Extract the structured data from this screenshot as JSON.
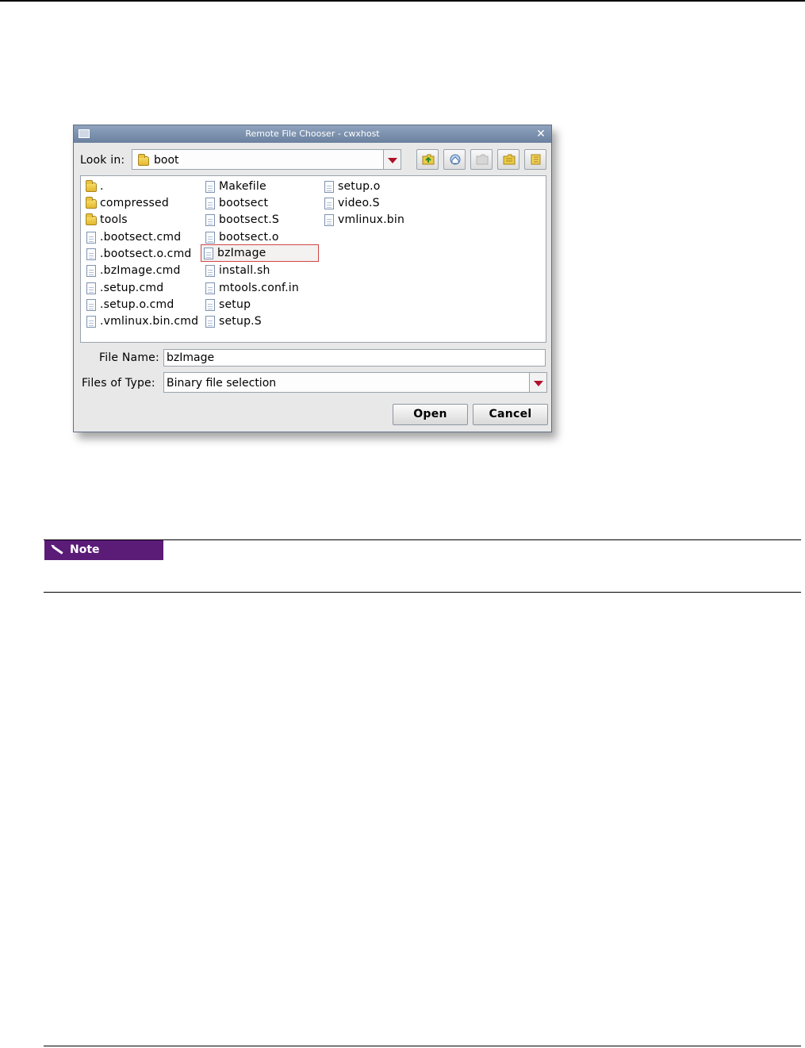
{
  "dialog": {
    "title": "Remote File Chooser - cwxhost",
    "close_glyph": "✕",
    "look_in_label": "Look in:",
    "look_in_value": "boot",
    "toolbar_icons": [
      "up-folder-icon",
      "home-icon",
      "new-folder-icon",
      "list-view-icon",
      "details-view-icon"
    ],
    "files": {
      "col1": [
        {
          "name": ".",
          "type": "folder"
        },
        {
          "name": "compressed",
          "type": "folder"
        },
        {
          "name": "tools",
          "type": "folder"
        },
        {
          "name": ".bootsect.cmd",
          "type": "file"
        },
        {
          "name": ".bootsect.o.cmd",
          "type": "file"
        },
        {
          "name": ".bzImage.cmd",
          "type": "file"
        },
        {
          "name": ".setup.cmd",
          "type": "file"
        },
        {
          "name": ".setup.o.cmd",
          "type": "file"
        },
        {
          "name": ".vmlinux.bin.cmd",
          "type": "file"
        }
      ],
      "col2": [
        {
          "name": "Makefile",
          "type": "file"
        },
        {
          "name": "bootsect",
          "type": "file"
        },
        {
          "name": "bootsect.S",
          "type": "file"
        },
        {
          "name": "bootsect.o",
          "type": "file"
        },
        {
          "name": "bzImage",
          "type": "file",
          "selected": true
        },
        {
          "name": "install.sh",
          "type": "file"
        },
        {
          "name": "mtools.conf.in",
          "type": "file"
        },
        {
          "name": "setup",
          "type": "file"
        },
        {
          "name": "setup.S",
          "type": "file"
        }
      ],
      "col3": [
        {
          "name": "setup.o",
          "type": "file"
        },
        {
          "name": "video.S",
          "type": "file"
        },
        {
          "name": "vmlinux.bin",
          "type": "file"
        }
      ]
    },
    "file_name_label": "File Name:",
    "file_name_value": "bzImage",
    "files_of_type_label": "Files of Type:",
    "files_of_type_value": "Binary file selection",
    "open_label": "Open",
    "cancel_label": "Cancel"
  },
  "note": {
    "label": "Note"
  },
  "colors": {
    "note_badge": "#5b1c78",
    "titlebar": "#7a90ad",
    "selection_outline": "#d04545",
    "combo_arrow": "#b0102a"
  }
}
